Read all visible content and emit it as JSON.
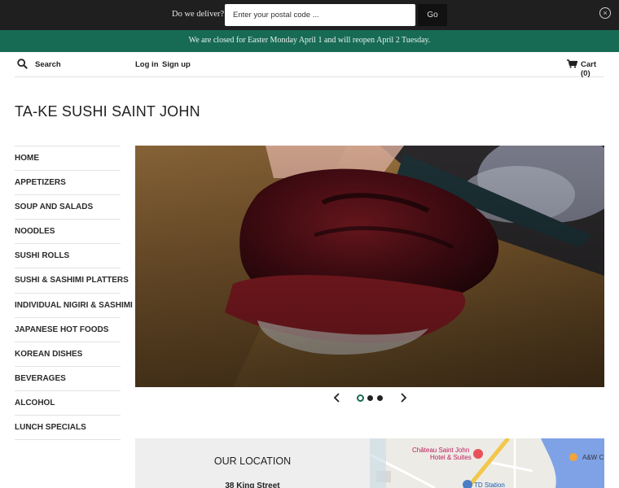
{
  "delivery": {
    "question": "Do we deliver?",
    "postal_placeholder": "Enter your postal code ...",
    "go_label": "Go",
    "close_glyph": "×"
  },
  "notice": {
    "text": "We are closed for Easter Monday April 1 and will reopen April 2 Tuesday."
  },
  "nav": {
    "search_label": "Search",
    "login_label": "Log in",
    "signup_label": "Sign up",
    "cart_label": "Cart (0)"
  },
  "store": {
    "title": "TA-KE SUSHI SAINT JOHN"
  },
  "sidebar": {
    "items": [
      {
        "label": "HOME"
      },
      {
        "label": "APPETIZERS"
      },
      {
        "label": "SOUP AND SALADS"
      },
      {
        "label": "NOODLES"
      },
      {
        "label": "SUSHI ROLLS"
      },
      {
        "label": "SUSHI & SASHIMI PLATTERS"
      },
      {
        "label": "INDIVIDUAL NIGIRI & SASHIMI"
      },
      {
        "label": "JAPANESE HOT FOODS"
      },
      {
        "label": "KOREAN DISHES"
      },
      {
        "label": "BEVERAGES"
      },
      {
        "label": "ALCOHOL"
      },
      {
        "label": "LUNCH SPECIALS"
      }
    ]
  },
  "slider": {
    "slide_count": 3,
    "active_index": 0
  },
  "location": {
    "heading": "OUR LOCATION",
    "address": "38 King Street"
  },
  "map": {
    "labels": [
      "Château Saint John",
      "Hotel & Suites",
      "TD Station",
      "A&W C"
    ]
  },
  "colors": {
    "accent": "#176b54",
    "delivery_bar": "#1f1f1f",
    "notice_text": "#e8f1ee"
  }
}
